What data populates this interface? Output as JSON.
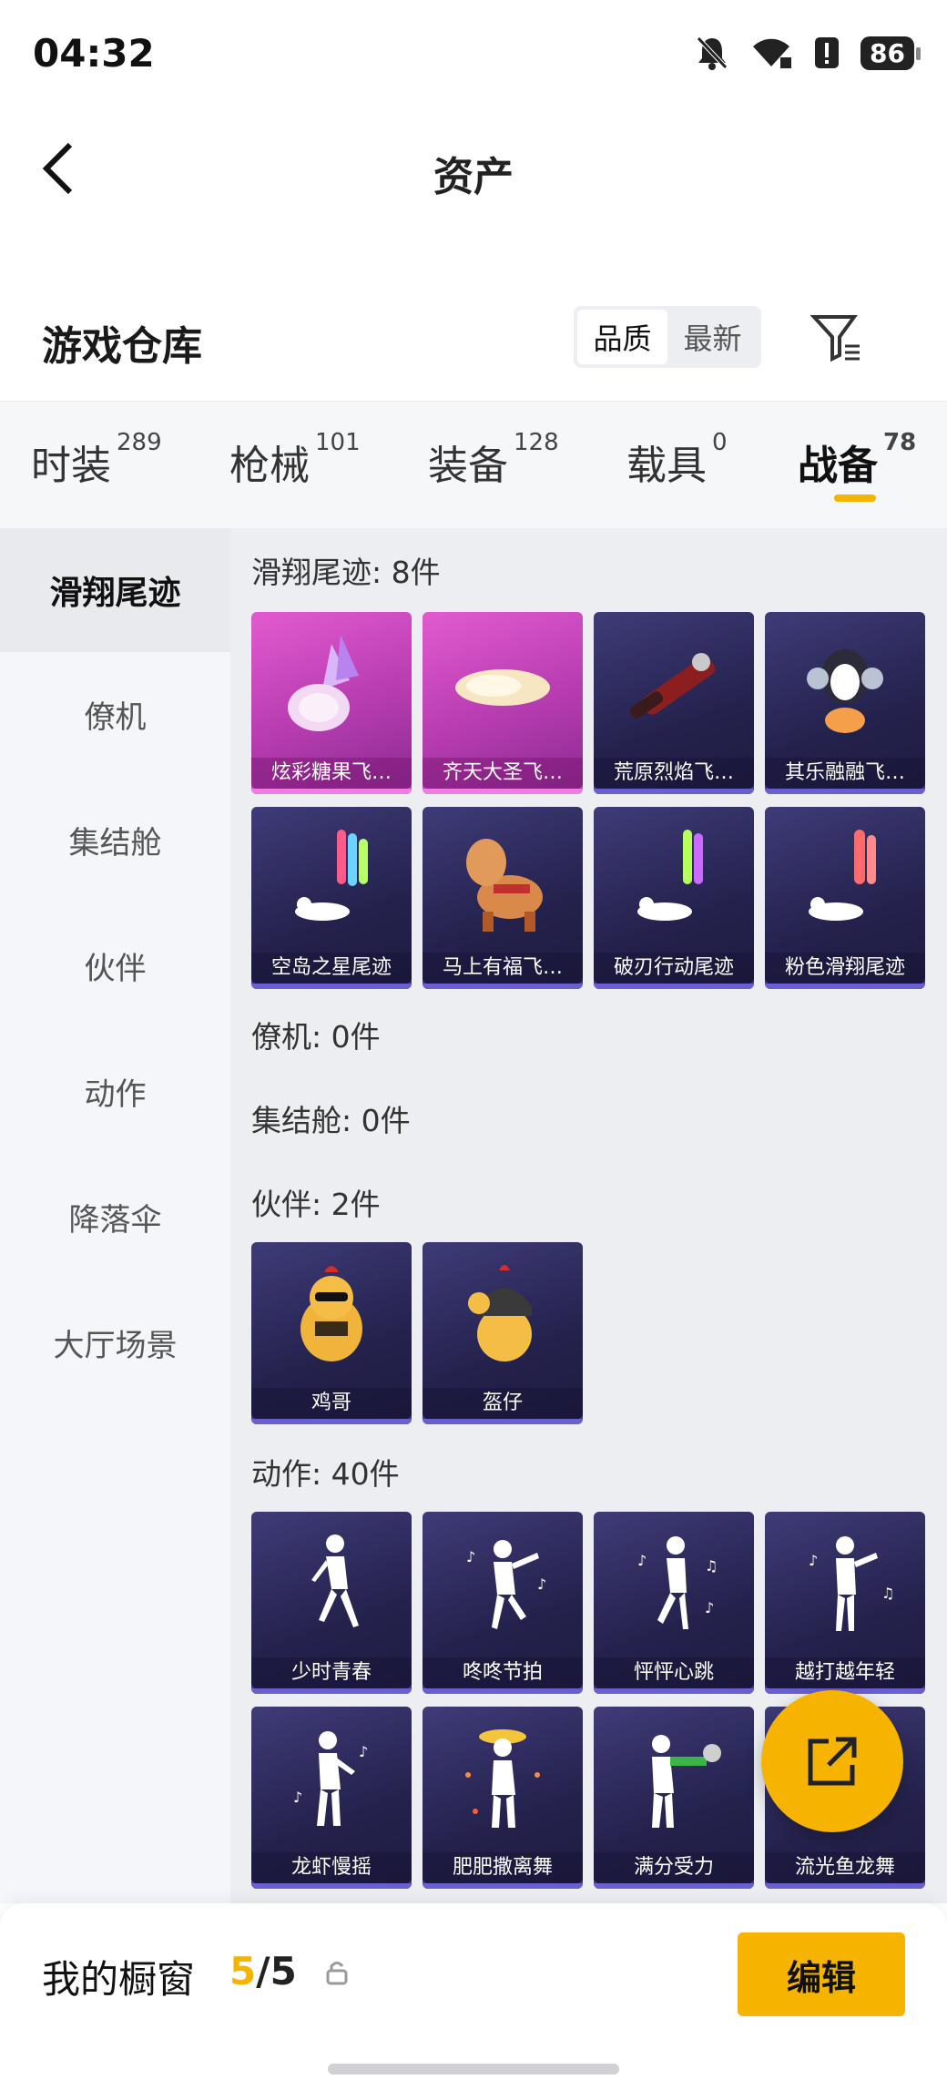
{
  "status_bar": {
    "time": "04:32",
    "battery": "86"
  },
  "header": {
    "title": "资产"
  },
  "warehouse": {
    "title": "游戏仓库",
    "sort_options": [
      "品质",
      "最新"
    ],
    "selected_sort": "品质"
  },
  "tabs": [
    {
      "label": "时装",
      "count": "289"
    },
    {
      "label": "枪械",
      "count": "101"
    },
    {
      "label": "装备",
      "count": "128"
    },
    {
      "label": "载具",
      "count": "0"
    },
    {
      "label": "战备",
      "count": "78",
      "active": true
    }
  ],
  "categories": [
    {
      "label": "滑翔尾迹",
      "active": true
    },
    {
      "label": "僚机"
    },
    {
      "label": "集结舱"
    },
    {
      "label": "伙伴"
    },
    {
      "label": "动作"
    },
    {
      "label": "降落伞"
    },
    {
      "label": "大厅场景"
    }
  ],
  "sections": {
    "trails": {
      "title": "滑翔尾迹: 8件",
      "items": [
        "炫彩糖果飞…",
        "齐天大圣飞…",
        "荒原烈焰飞…",
        "其乐融融飞…",
        "空岛之星尾迹",
        "马上有福飞…",
        "破刃行动尾迹",
        "粉色滑翔尾迹"
      ]
    },
    "wingman": {
      "title": "僚机: 0件"
    },
    "capsule": {
      "title": "集结舱: 0件"
    },
    "partners": {
      "title": "伙伴: 2件",
      "items": [
        "鸡哥",
        "盔仔"
      ]
    },
    "emotes": {
      "title": "动作: 40件",
      "items": [
        "少时青春",
        "咚咚节拍",
        "怦怦心跳",
        "越打越年轻",
        "龙虾慢摇",
        "肥肥撒离舞",
        "满分受力",
        "流光鱼龙舞"
      ]
    }
  },
  "showcase": {
    "label": "我的橱窗",
    "current": "5",
    "total": "/5",
    "edit_label": "编辑"
  },
  "colors": {
    "accent": "#f6b400",
    "card_dark": "#2a2757",
    "card_pink": "#c843bf"
  }
}
